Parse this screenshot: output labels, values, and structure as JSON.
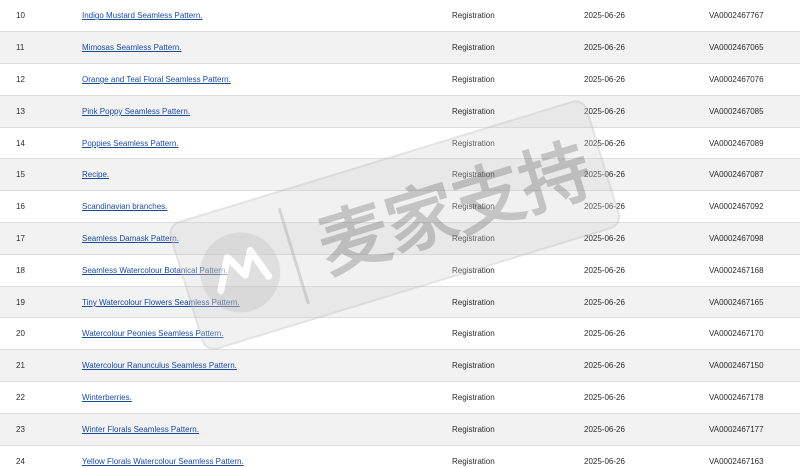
{
  "records": {
    "rows": [
      {
        "num": "10",
        "title": "Indigo Mustard Seamless Pattern.",
        "type": "Registration",
        "date": "2025-06-26",
        "reg": "VA0002467767"
      },
      {
        "num": "11",
        "title": "Mimosas Seamless Pattern.",
        "type": "Registration",
        "date": "2025-06-26",
        "reg": "VA0002467065"
      },
      {
        "num": "12",
        "title": "Orange and Teal Floral Seamless Pattern.",
        "type": "Registration",
        "date": "2025-06-26",
        "reg": "VA0002467076"
      },
      {
        "num": "13",
        "title": "Pink Poppy Seamless Pattern.",
        "type": "Registration",
        "date": "2025-06-26",
        "reg": "VA0002467085"
      },
      {
        "num": "14",
        "title": "Poppies Seamless Pattern.",
        "type": "Registration",
        "date": "2025-06-26",
        "reg": "VA0002467089"
      },
      {
        "num": "15",
        "title": "Recipe.",
        "type": "Registration",
        "date": "2025-06-26",
        "reg": "VA0002467087"
      },
      {
        "num": "16",
        "title": "Scandinavian branches.",
        "type": "Registration",
        "date": "2025-06-26",
        "reg": "VA0002467092"
      },
      {
        "num": "17",
        "title": "Seamless Damask Pattern.",
        "type": "Registration",
        "date": "2025-06-26",
        "reg": "VA0002467098"
      },
      {
        "num": "18",
        "title": "Seamless Watercolour Botanical Pattern.",
        "type": "Registration",
        "date": "2025-06-26",
        "reg": "VA0002467168"
      },
      {
        "num": "19",
        "title": "Tiny Watercolour Flowers Seamless Pattern.",
        "type": "Registration",
        "date": "2025-06-26",
        "reg": "VA0002467165"
      },
      {
        "num": "20",
        "title": "Watercolour Peonies Seamless Pattern.",
        "type": "Registration",
        "date": "2025-06-26",
        "reg": "VA0002467170"
      },
      {
        "num": "21",
        "title": "Watercolour Ranunculus Seamless Pattern.",
        "type": "Registration",
        "date": "2025-06-26",
        "reg": "VA0002467150"
      },
      {
        "num": "22",
        "title": "Winterberries.",
        "type": "Registration",
        "date": "2025-06-26",
        "reg": "VA0002467178"
      },
      {
        "num": "23",
        "title": "Winter Florals Seamless Pattern.",
        "type": "Registration",
        "date": "2025-06-26",
        "reg": "VA0002467177"
      },
      {
        "num": "24",
        "title": "Yellow Florals Watercolour Seamless Pattern.",
        "type": "Registration",
        "date": "2025-06-26",
        "reg": "VA0002467163"
      }
    ]
  },
  "watermark": {
    "text": "麦家支持",
    "icon": "maijia-logo-icon"
  },
  "colors": {
    "link": "#1a4a9c",
    "row_alt": "#f2f2f2",
    "watermark": "#8a8a8a"
  }
}
